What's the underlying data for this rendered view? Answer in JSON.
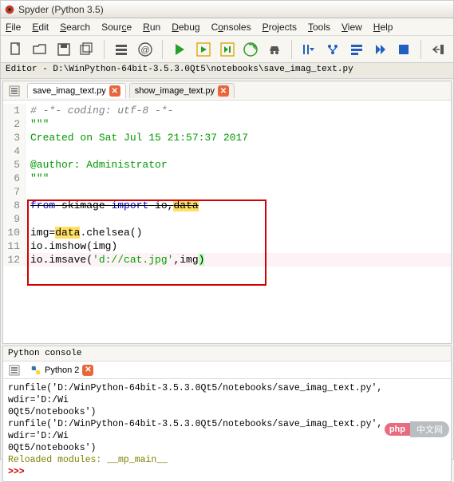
{
  "window": {
    "title": "Spyder (Python 3.5)"
  },
  "menu": {
    "file": "File",
    "edit": "Edit",
    "search": "Search",
    "source": "Source",
    "run": "Run",
    "debug": "Debug",
    "consoles": "Consoles",
    "projects": "Projects",
    "tools": "Tools",
    "view": "View",
    "help": "Help"
  },
  "toolbar": {
    "new": "new-file",
    "open": "open-file",
    "save": "save",
    "saveall": "save-all",
    "cell_block": "cell-block",
    "email": "email",
    "run": "run",
    "run_cell": "run-cell",
    "run_cell_adv": "run-cell-advance",
    "run_selection": "run-selection",
    "debug": "debug",
    "step_over": "step-over",
    "step_into": "step-into",
    "step_out": "step-out",
    "continue": "continue",
    "stop": "stop",
    "last": "last-edit"
  },
  "editor": {
    "path_label": "Editor - D:\\WinPython-64bit-3.5.3.0Qt5\\notebooks\\save_imag_text.py",
    "tabs": [
      {
        "label": "save_imag_text.py",
        "active": true
      },
      {
        "label": "show_image_text.py",
        "active": false
      }
    ],
    "lines": [
      {
        "n": "1",
        "type": "comment",
        "text": "# -*- coding: utf-8 -*-"
      },
      {
        "n": "2",
        "type": "docstr",
        "text": "\"\"\""
      },
      {
        "n": "3",
        "type": "docstr",
        "text": "Created on Sat Jul 15 21:57:37 2017"
      },
      {
        "n": "4",
        "type": "docstr",
        "text": ""
      },
      {
        "n": "5",
        "type": "docstr",
        "text": "@author: Administrator"
      },
      {
        "n": "6",
        "type": "docstr",
        "text": "\"\"\""
      },
      {
        "n": "7",
        "type": "plain",
        "text": ""
      },
      {
        "n": "8",
        "type": "import",
        "kw": "from",
        "mod": "skimage",
        "kw2": "import",
        "names": "io,",
        "hl": "data"
      },
      {
        "n": "9",
        "type": "plain",
        "text": ""
      },
      {
        "n": "10",
        "type": "code_hl",
        "pre": "img=",
        "hl": "data",
        "post": ".chelsea()"
      },
      {
        "n": "11",
        "type": "plain",
        "text": "io.imshow(img)"
      },
      {
        "n": "12",
        "type": "imsave",
        "pre": "io.imsave(",
        "str": "'d://cat.jpg'",
        "mid": ",img",
        "paren": ")"
      }
    ]
  },
  "console": {
    "header": "Python console",
    "tab": "Python 2",
    "lines": [
      "runfile('D:/WinPython-64bit-3.5.3.0Qt5/notebooks/save_imag_text.py', wdir='D:/Wi",
      "0Qt5/notebooks')",
      "runfile('D:/WinPython-64bit-3.5.3.0Qt5/notebooks/save_imag_text.py', wdir='D:/Wi",
      "0Qt5/notebooks')"
    ],
    "reloaded": "Reloaded modules: __mp_main__",
    "prompt": ">>>"
  },
  "watermark": {
    "left": "php",
    "right": "中文网"
  }
}
